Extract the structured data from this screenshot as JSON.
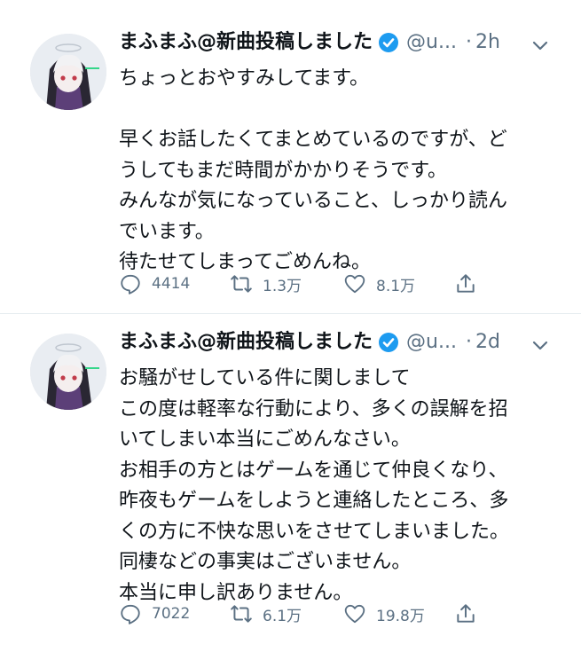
{
  "tweets": [
    {
      "name": "まふまふ@新曲投稿しました",
      "handle": "@u...",
      "separator": "·",
      "time": "2h",
      "lines": [
        "ちょっとおやすみしてます。",
        "",
        "早くお話したくてまとめているのですが、ど",
        "うしてもまだ時間がかかりそうです。",
        "みんなが気になっていること、しっかり読ん",
        "でいます。",
        "待たせてしまってごめんね。"
      ],
      "replies": "4414",
      "retweets": "1.3万",
      "likes": "8.1万"
    },
    {
      "name": "まふまふ@新曲投稿しました",
      "handle": "@u...",
      "separator": "·",
      "time": "2d",
      "lines": [
        "お騒がせしている件に関しまして",
        "この度は軽率な行動により、多くの誤解を招",
        "いてしまい本当にごめんなさい。",
        "お相手の方とはゲームを通じて仲良くなり、",
        "昨夜もゲームをしようと連絡したところ、多",
        "くの方に不快な思いをさせてしまいました。",
        "同棲などの事実はございません。",
        "本当に申し訳ありません。"
      ],
      "replies": "7022",
      "retweets": "6.1万",
      "likes": "19.8万"
    }
  ],
  "colors": {
    "verified": "#1d9bf0",
    "muted": "#5b7083",
    "text": "#0f1419",
    "divider": "#e6ecf0"
  },
  "icons": [
    "avatar",
    "verified-badge-icon",
    "more-icon",
    "reply-icon",
    "retweet-icon",
    "like-icon",
    "share-icon"
  ]
}
